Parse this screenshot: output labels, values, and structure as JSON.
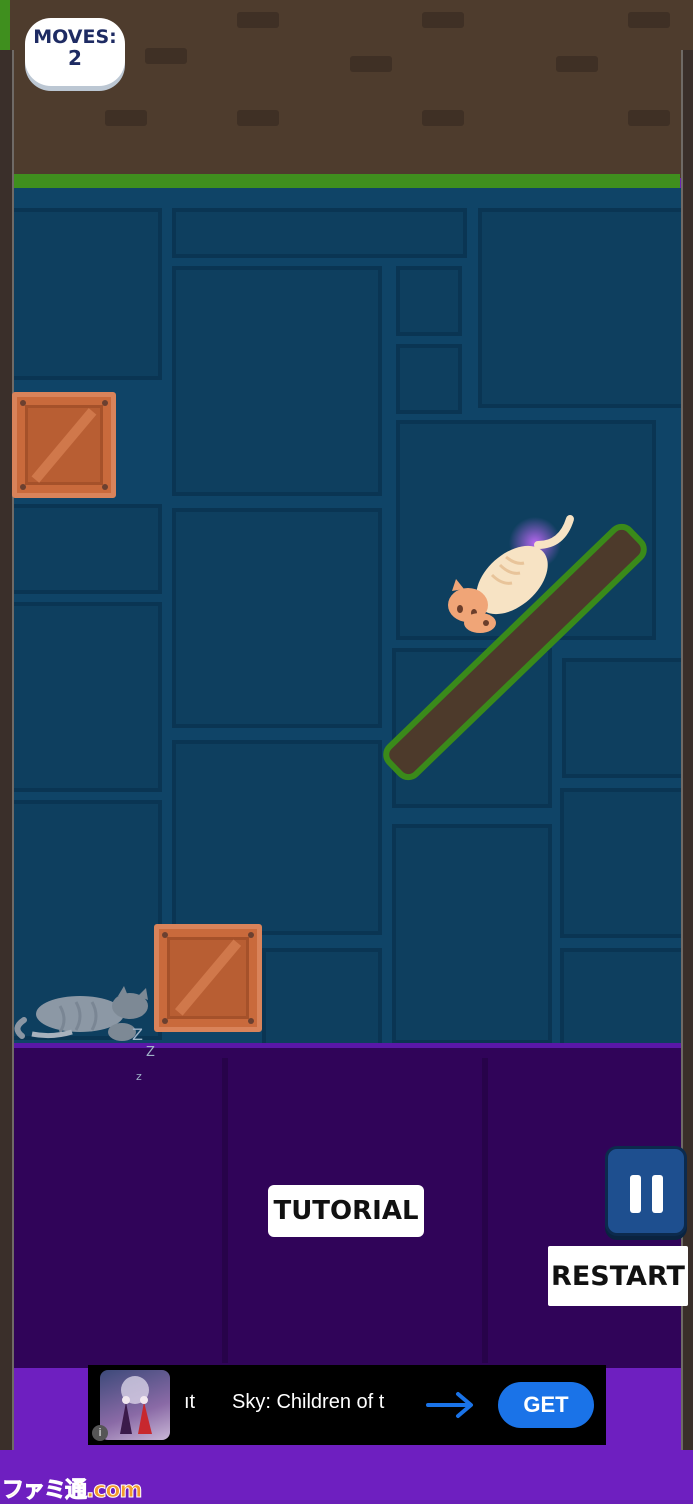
{
  "hud": {
    "moves_label": "MOVES:",
    "moves_value": "2"
  },
  "buttons": {
    "tutorial_label": "TUTORIAL",
    "restart_label": "RESTART",
    "pause_icon": "pause-icon"
  },
  "ad": {
    "partial_text": "ıt",
    "title": "Sky: Children of t",
    "arrow_icon": "arrow-right-icon",
    "get_label": "GET",
    "info_icon": "info-icon"
  },
  "watermark": "ファミ通.com",
  "colors": {
    "background_blue": "#0f4467",
    "floor_purple": "#300459",
    "grass": "#3f8f1e",
    "ad_button": "#1a73e8"
  }
}
